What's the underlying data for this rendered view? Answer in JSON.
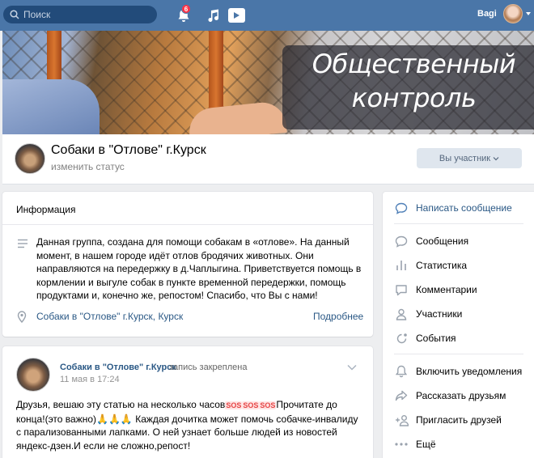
{
  "topbar": {
    "search_placeholder": "Поиск",
    "notifications_count": "6",
    "user_name": "Bagi"
  },
  "cover": {
    "title_line1": "Общественный",
    "title_line2": "контроль"
  },
  "group": {
    "name": "Собаки в \"Отлове\" г.Курск",
    "status": "изменить статус",
    "member_button": "Вы участник"
  },
  "info": {
    "heading": "Информация",
    "description": "Данная группа, создана для помощи собакам в «отлове». На данный момент, в нашем городе идёт отлов бродячих животных. Они направляются на передержку в д.Чаплыгина. Приветствуется помощь в кормлении и выгуле собак в пункте временной передержки, помощь продуктами и, конечно же, репостом! Спасибо, что Вы с нами!",
    "location": "Собаки в \"Отлове\" г.Курск, Курск",
    "more_link": "Подробнее"
  },
  "post": {
    "author": "Собаки в \"Отлове\" г.Курск",
    "action": "запись закреплена",
    "date": "11 мая в 17:24",
    "text_part1": "Друзья, вешаю эту статью на несколько часов",
    "emoji_sos": "SOS",
    "text_part2": "Прочитате до конца!(это важно)",
    "emoji_hands": "🙏🙏🙏",
    "text_part3": "Каждая дочитка может помочь собачке-инвалиду с парализованными лапками. О ней узнает больше людей из новостей яндекс-дзен.И если не сложно,репост!"
  },
  "menu": {
    "primary": {
      "label": "Написать сообщение",
      "icon": "chat-bubble-icon"
    },
    "items": [
      {
        "label": "Сообщения",
        "icon": "chat-icon"
      },
      {
        "label": "Статистика",
        "icon": "bar-chart-icon"
      },
      {
        "label": "Комментарии",
        "icon": "comment-icon"
      },
      {
        "label": "Участники",
        "icon": "user-icon"
      },
      {
        "label": "События",
        "icon": "event-icon"
      }
    ],
    "items2": [
      {
        "label": "Включить уведомления",
        "icon": "bell-icon"
      },
      {
        "label": "Рассказать друзьям",
        "icon": "share-icon"
      },
      {
        "label": "Пригласить друзей",
        "icon": "add-user-icon"
      },
      {
        "label": "Ещё",
        "icon": "more-icon"
      }
    ]
  },
  "colors": {
    "header_bg": "#4a76a8",
    "link": "#2a5885",
    "page_bg": "#edeef0"
  }
}
